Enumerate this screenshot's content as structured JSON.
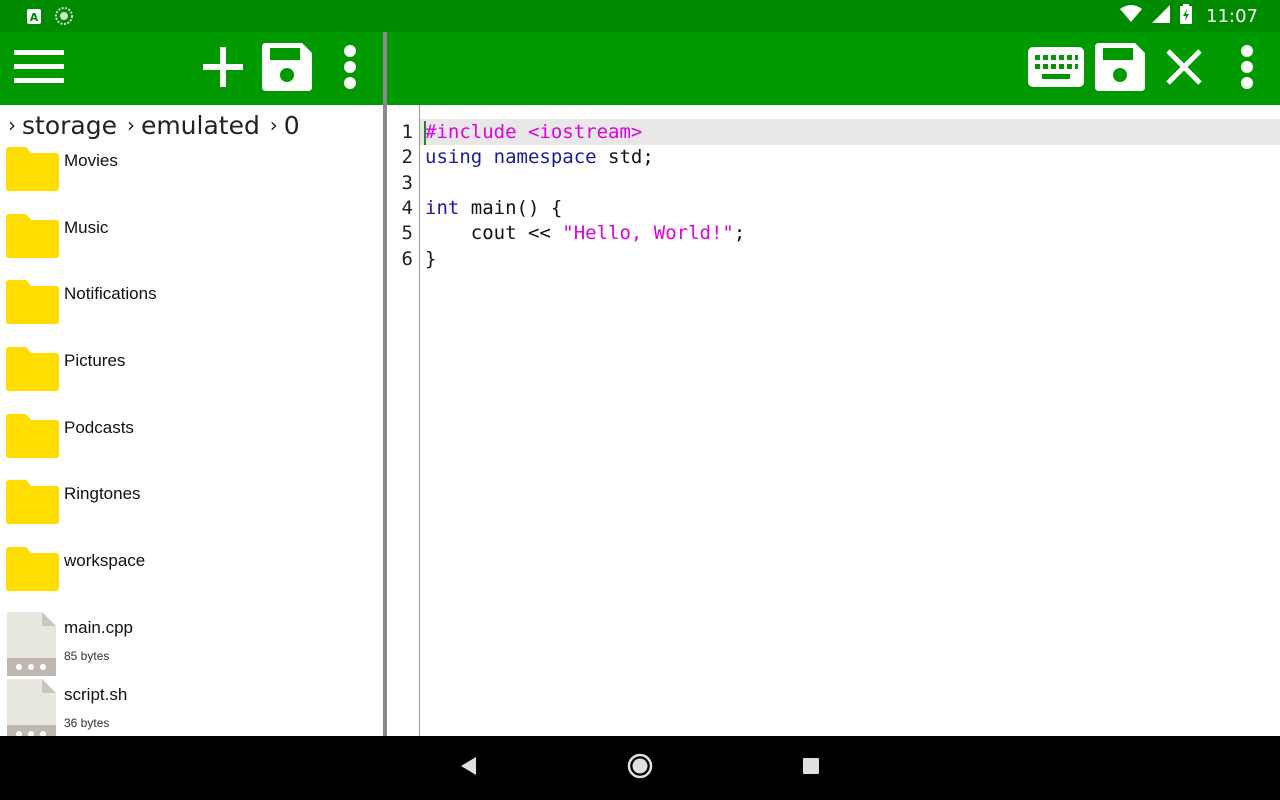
{
  "status_bar": {
    "time": "11:07",
    "left_icons": [
      "app-a-icon",
      "spinner-icon"
    ],
    "right_icons": [
      "wifi-icon",
      "signal-icon",
      "battery-icon"
    ]
  },
  "left_toolbar": {
    "buttons": [
      "menu-icon",
      "add-icon",
      "save-icon",
      "more-vert-icon"
    ]
  },
  "right_toolbar": {
    "buttons": [
      "keyboard-icon",
      "save-icon",
      "close-icon",
      "more-vert-icon"
    ]
  },
  "explorer": {
    "breadcrumb": [
      "storage",
      "emulated",
      "0"
    ],
    "items": [
      {
        "name": "Movies",
        "type": "folder"
      },
      {
        "name": "Music",
        "type": "folder"
      },
      {
        "name": "Notifications",
        "type": "folder"
      },
      {
        "name": "Pictures",
        "type": "folder"
      },
      {
        "name": "Podcasts",
        "type": "folder"
      },
      {
        "name": "Ringtones",
        "type": "folder"
      },
      {
        "name": "workspace",
        "type": "folder"
      },
      {
        "name": "main.cpp",
        "type": "file",
        "size": "85 bytes"
      },
      {
        "name": "script.sh",
        "type": "file",
        "size": "36 bytes"
      }
    ]
  },
  "editor": {
    "line_numbers": [
      "1",
      "2",
      "3",
      "4",
      "5",
      "6"
    ],
    "lines": [
      [
        {
          "t": "#include <iostream>",
          "c": "pre"
        }
      ],
      [
        {
          "t": "using namespace",
          "c": "kw"
        },
        {
          "t": " std;",
          "c": ""
        }
      ],
      [],
      [
        {
          "t": "int",
          "c": "kw"
        },
        {
          "t": " main() {",
          "c": ""
        }
      ],
      [
        {
          "t": "    cout << ",
          "c": ""
        },
        {
          "t": "\"Hello, World!\"",
          "c": "str"
        },
        {
          "t": ";",
          "c": ""
        }
      ],
      [
        {
          "t": "}",
          "c": ""
        }
      ]
    ]
  },
  "nav_bar": {
    "buttons": [
      "back-icon",
      "home-icon",
      "recents-icon"
    ]
  },
  "colors": {
    "toolbar": "#009a00",
    "status_bar": "#008a00",
    "folder": "#ffd600",
    "preprocessor": "#e000e0",
    "keyword": "#1a1aa6",
    "string": "#e000e0"
  }
}
